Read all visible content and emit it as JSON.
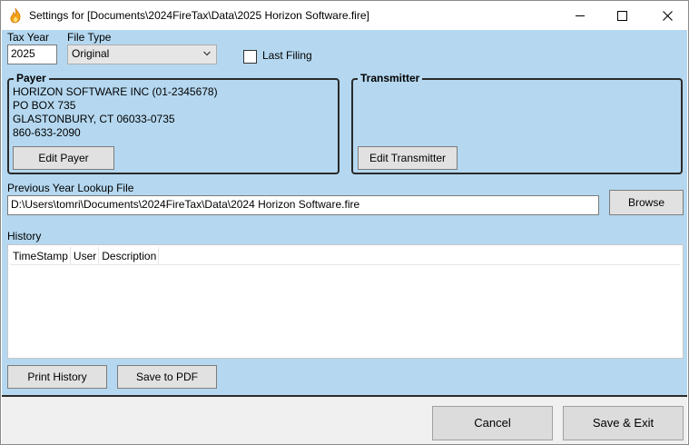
{
  "window": {
    "title": "Settings for [Documents\\2024FireTax\\Data\\2025 Horizon Software.fire]",
    "app_icon": "flame-icon",
    "controls": [
      "minimize-icon",
      "maximize-icon",
      "close-icon"
    ]
  },
  "tax_year": {
    "label": "Tax Year",
    "value": "2025"
  },
  "file_type": {
    "label": "File Type",
    "value": "Original"
  },
  "last_filing": {
    "label": "Last Filing",
    "checked": false
  },
  "payer": {
    "legend": "Payer",
    "lines": [
      "HORIZON SOFTWARE INC  (01-2345678)",
      "PO BOX 735",
      "GLASTONBURY,  CT   06033-0735",
      "860-633-2090"
    ],
    "edit_label": "Edit Payer"
  },
  "transmitter": {
    "legend": "Transmitter",
    "edit_label": "Edit Transmitter"
  },
  "lookup": {
    "label": "Previous Year Lookup File",
    "value": "D:\\Users\\tomri\\Documents\\2024FireTax\\Data\\2024 Horizon Software.fire",
    "browse_label": "Browse"
  },
  "history": {
    "label": "History",
    "columns": [
      "TimeStamp",
      "User",
      "Description"
    ],
    "print_label": "Print History",
    "pdf_label": "Save to PDF"
  },
  "footer": {
    "cancel_label": "Cancel",
    "save_exit_label": "Save & Exit"
  },
  "colors": {
    "panel_bg": "#b5d8f0",
    "footer_bg": "#f0f0f0",
    "flame": "#f5a21b"
  }
}
